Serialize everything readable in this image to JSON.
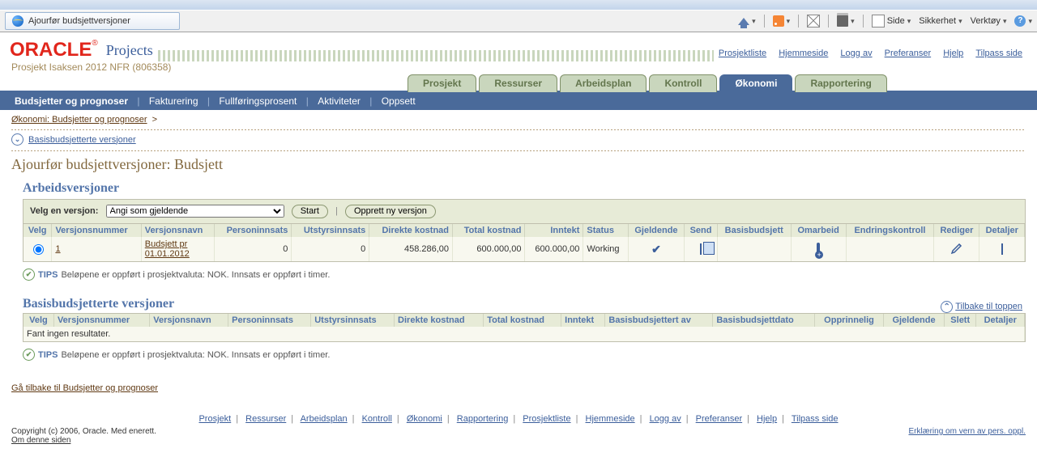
{
  "browser": {
    "tab_title": "Ajourfør budsjettversjoner",
    "toolbar": [
      "Side",
      "Sikkerhet",
      "Verktøy"
    ]
  },
  "app": {
    "brand": "ORACLE",
    "product": "Projects",
    "subtitle": "Prosjekt Isaksen 2012 NFR (806358)"
  },
  "global_links": [
    "Prosjektliste",
    "Hjemmeside",
    "Logg av",
    "Preferanser",
    "Hjelp",
    "Tilpass side"
  ],
  "main_tabs": [
    {
      "label": "Prosjekt"
    },
    {
      "label": "Ressurser"
    },
    {
      "label": "Arbeidsplan"
    },
    {
      "label": "Kontroll"
    },
    {
      "label": "Økonomi",
      "active": true
    },
    {
      "label": "Rapportering"
    }
  ],
  "subnav": {
    "items": [
      "Budsjetter og prognoser",
      "Fakturering",
      "Fullføringsprosent",
      "Aktiviteter",
      "Oppsett"
    ],
    "current_index": 0
  },
  "breadcrumb": {
    "link": "Økonomi: Budsjetter og prognoser",
    "sep": ">"
  },
  "collapse_link": "Basisbudsjetterte versjoner",
  "page_title": "Ajourfør budsjettversjoner: Budsjett",
  "work_versions": {
    "section_title": "Arbeidsversjoner",
    "select_label": "Velg en versjon:",
    "select_value": "Angi som gjeldende",
    "start_btn": "Start",
    "create_btn": "Opprett ny versjon",
    "headers": [
      "Velg",
      "Versjonsnummer",
      "Versjonsnavn",
      "Personinnsats",
      "Utstyrsinnsats",
      "Direkte kostnad",
      "Total kostnad",
      "Inntekt",
      "Status",
      "Gjeldende",
      "Send",
      "Basisbudsjett",
      "Omarbeid",
      "Endringskontroll",
      "Rediger",
      "Detaljer"
    ],
    "row": {
      "version_number": "1",
      "version_name_l1": "Budsjett pr",
      "version_name_l2": "01.01.2012",
      "person": "0",
      "equip": "0",
      "direct": "458.286,00",
      "total": "600.000,00",
      "income": "600.000,00",
      "status": "Working"
    },
    "tip_label": "TIPS",
    "tip_text": "Beløpene er oppført i prosjektvaluta: NOK. Innsats er oppført i timer."
  },
  "base_versions": {
    "section_title": "Basisbudsjetterte versjoner",
    "back_top": "Tilbake til toppen",
    "headers": [
      "Velg",
      "Versjonsnummer",
      "Versjonsnavn",
      "Personinnsats",
      "Utstyrsinnsats",
      "Direkte kostnad",
      "Total kostnad",
      "Inntekt",
      "Basisbudsjettert av",
      "Basisbudsjettdato",
      "Opprinnelig",
      "Gjeldende",
      "Slett",
      "Detaljer"
    ],
    "empty": "Fant ingen resultater.",
    "tip_label": "TIPS",
    "tip_text": "Beløpene er oppført i prosjektvaluta: NOK. Innsats er oppført i timer."
  },
  "back_link": "Gå tilbake til Budsjetter og prognoser",
  "footer_links": [
    "Prosjekt",
    "Ressurser",
    "Arbeidsplan",
    "Kontroll",
    "Økonomi",
    "Rapportering",
    "Prosjektliste",
    "Hjemmeside",
    "Logg av",
    "Preferanser",
    "Hjelp",
    "Tilpass side"
  ],
  "copyright": "Copyright (c) 2006, Oracle. Med enerett.",
  "about_page": "Om denne siden",
  "privacy": "Erklæring om vern av pers. oppl."
}
